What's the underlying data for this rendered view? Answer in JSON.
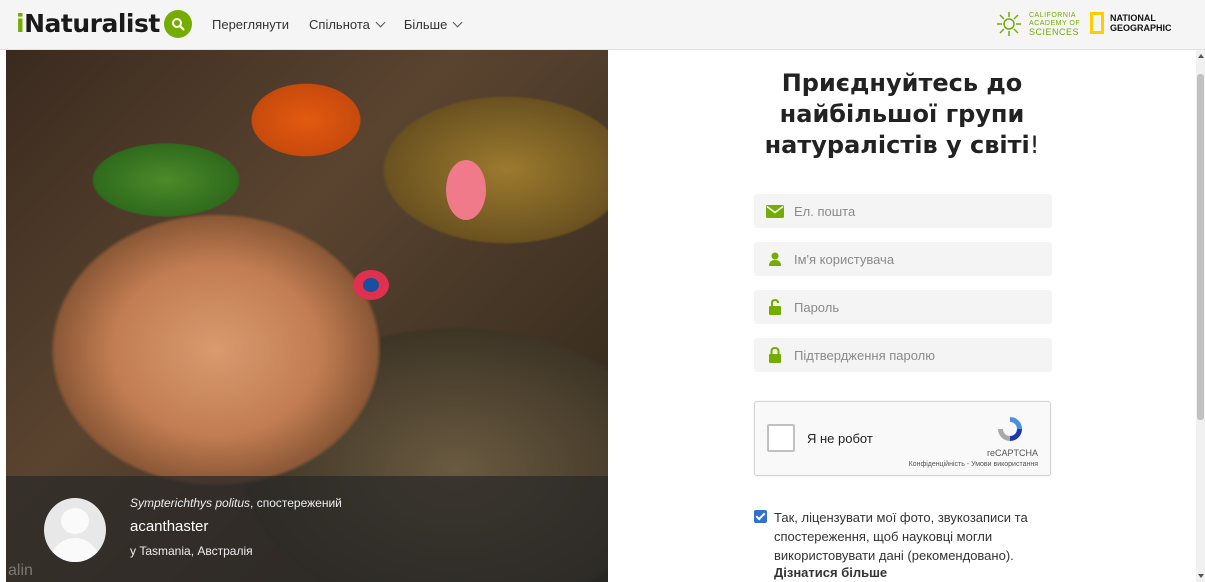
{
  "header": {
    "logo_prefix": "i",
    "logo_rest": "Naturalist",
    "nav": [
      {
        "label": "Переглянути",
        "has_menu": false
      },
      {
        "label": "Спільнота",
        "has_menu": true
      },
      {
        "label": "Більше",
        "has_menu": true
      }
    ],
    "partner_cas_lines": [
      "CALIFORNIA",
      "ACADEMY OF",
      "SCIENCES"
    ],
    "partner_ng_lines": [
      "NATIONAL",
      "GEOGRAPHIC"
    ]
  },
  "photo": {
    "species": "Sympterichthys politus",
    "species_suffix": ", спостережений",
    "user": "acanthaster",
    "place": "у Tasmania, Австралія",
    "watermark": "alin"
  },
  "signup": {
    "headline_lines": [
      "Приєднуйтесь до",
      "найбільшої групи",
      "натуралістів у світі"
    ],
    "headline_excl": "!",
    "fields": {
      "email": {
        "placeholder": "Ел. пошта",
        "icon": "envelope-icon"
      },
      "username": {
        "placeholder": "Ім'я користувача",
        "icon": "user-icon"
      },
      "password": {
        "placeholder": "Пароль",
        "icon": "unlock-icon"
      },
      "password_confirm": {
        "placeholder": "Підтвердження паролю",
        "icon": "lock-icon"
      }
    },
    "captcha": {
      "label": "Я не робот",
      "brand": "reCAPTCHA",
      "links": "Конфіденційність - Умови використання"
    },
    "consent": {
      "checked": true,
      "text": "Так, ліцензувати мої фото, звукозаписи та спостереження, щоб науковці могли використовувати дані (рекомендовано).",
      "learn_more": "Дізнатися більше"
    }
  },
  "colors": {
    "brand_green": "#74ac00",
    "checkbox_blue": "#2f6fd6",
    "natgeo_yellow": "#ffce00"
  }
}
